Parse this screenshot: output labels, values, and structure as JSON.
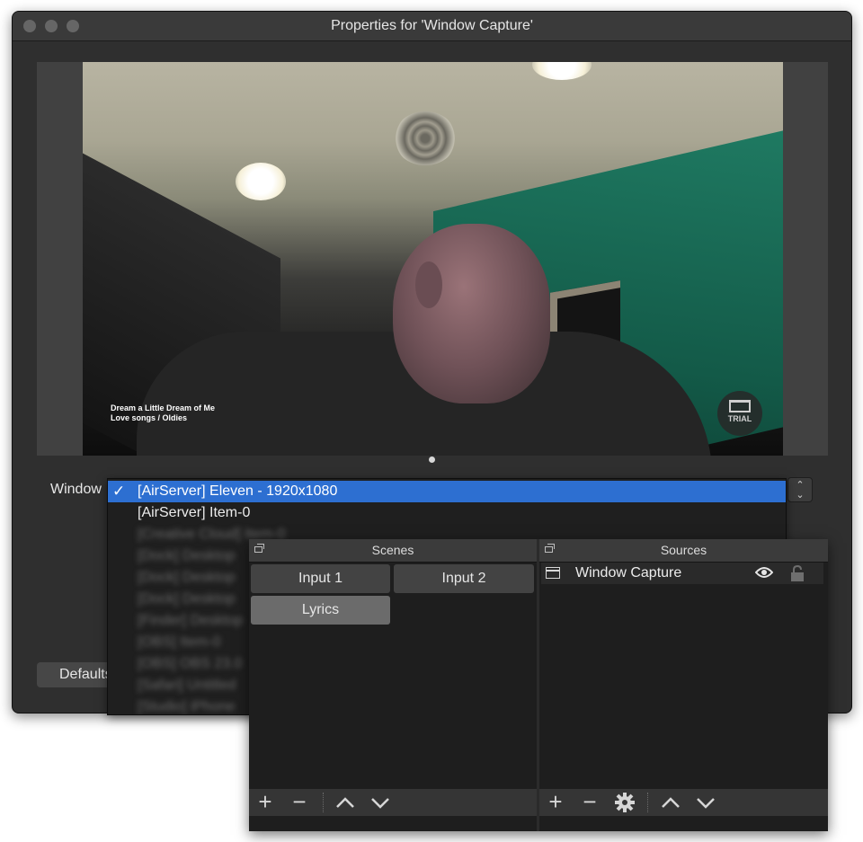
{
  "properties_window": {
    "title": "Properties for 'Window Capture'",
    "preview": {
      "song_title": "Dream a Little Dream of Me",
      "song_subtitle": "Love songs  / Oldies",
      "badge_label": "TRIAL"
    },
    "window_label": "Window",
    "defaults_button": "Defaults",
    "window_dropdown": {
      "checkmark": "✓",
      "items": [
        {
          "label": "[AirServer] Eleven - 1920x1080",
          "selected": true
        },
        {
          "label": "[AirServer] Item-0",
          "selected": false
        },
        {
          "label": "[Creative Cloud] Item-0",
          "selected": false
        },
        {
          "label": "[Dock] Desktop",
          "selected": false
        },
        {
          "label": "[Dock] Desktop",
          "selected": false
        },
        {
          "label": "[Dock] Desktop",
          "selected": false
        },
        {
          "label": "[Finder] Desktop",
          "selected": false
        },
        {
          "label": "[OBS] Item-0",
          "selected": false
        },
        {
          "label": "[OBS] OBS 23.0",
          "selected": false
        },
        {
          "label": "[Safari] Untitled",
          "selected": false
        },
        {
          "label": "[Studio] iPhone",
          "selected": false
        }
      ]
    }
  },
  "scenes_panel": {
    "title": "Scenes",
    "scenes": [
      {
        "label": "Input 1",
        "active": false
      },
      {
        "label": "Input 2",
        "active": false
      },
      {
        "label": "Lyrics",
        "active": true
      }
    ]
  },
  "sources_panel": {
    "title": "Sources",
    "sources": [
      {
        "label": "Window Capture",
        "visible": true,
        "locked": false
      }
    ]
  },
  "toolbar_glyphs": {
    "add": "+",
    "remove": "−",
    "up": "˄",
    "down": "˅"
  }
}
